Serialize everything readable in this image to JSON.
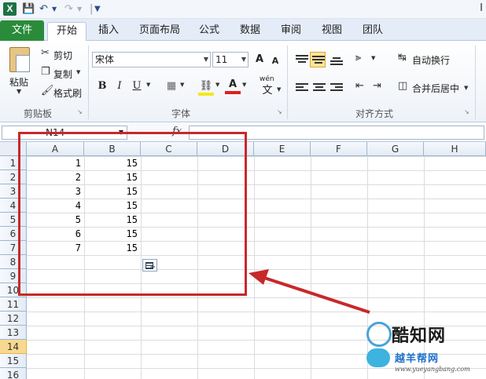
{
  "window": {
    "title_char": "I"
  },
  "tabs": [
    {
      "label": "文件"
    },
    {
      "label": "开始"
    },
    {
      "label": "插入"
    },
    {
      "label": "页面布局"
    },
    {
      "label": "公式"
    },
    {
      "label": "数据"
    },
    {
      "label": "审阅"
    },
    {
      "label": "视图"
    },
    {
      "label": "团队"
    }
  ],
  "ribbon": {
    "clipboard": {
      "paste": "粘贴",
      "cut": "剪切",
      "copy": "复制",
      "format_painter": "格式刷",
      "group": "剪贴板"
    },
    "font": {
      "name": "宋体",
      "size": "11",
      "group": "字体",
      "bold": "B",
      "italic": "I",
      "underline": "U",
      "grow": "A",
      "shrink": "A",
      "font_color": "A",
      "wen": "wén",
      "wen_char": "文"
    },
    "alignment": {
      "wrap": "自动换行",
      "merge": "合并后居中",
      "group": "对齐方式"
    }
  },
  "formula_bar": {
    "name_box": "N14",
    "fx": "fx"
  },
  "sheet": {
    "columns": [
      "A",
      "B",
      "C",
      "D",
      "E",
      "F",
      "G",
      "H"
    ],
    "rows": [
      "1",
      "2",
      "3",
      "4",
      "5",
      "6",
      "7",
      "8",
      "9",
      "10",
      "11",
      "12",
      "13",
      "14",
      "15",
      "16"
    ],
    "selected_row": "14",
    "col_a": [
      "1",
      "2",
      "3",
      "4",
      "5",
      "6",
      "7"
    ],
    "col_b": [
      "15",
      "15",
      "15",
      "15",
      "15",
      "15",
      "15"
    ]
  },
  "colors": {
    "file_tab": "#2a8c3a",
    "annotation": "#c8282a",
    "row_highlight": "#f9d98f"
  },
  "watermark": {
    "line1": "酷知网",
    "line2": "越羊帮网",
    "line3": "www.yueyangbang.com"
  }
}
